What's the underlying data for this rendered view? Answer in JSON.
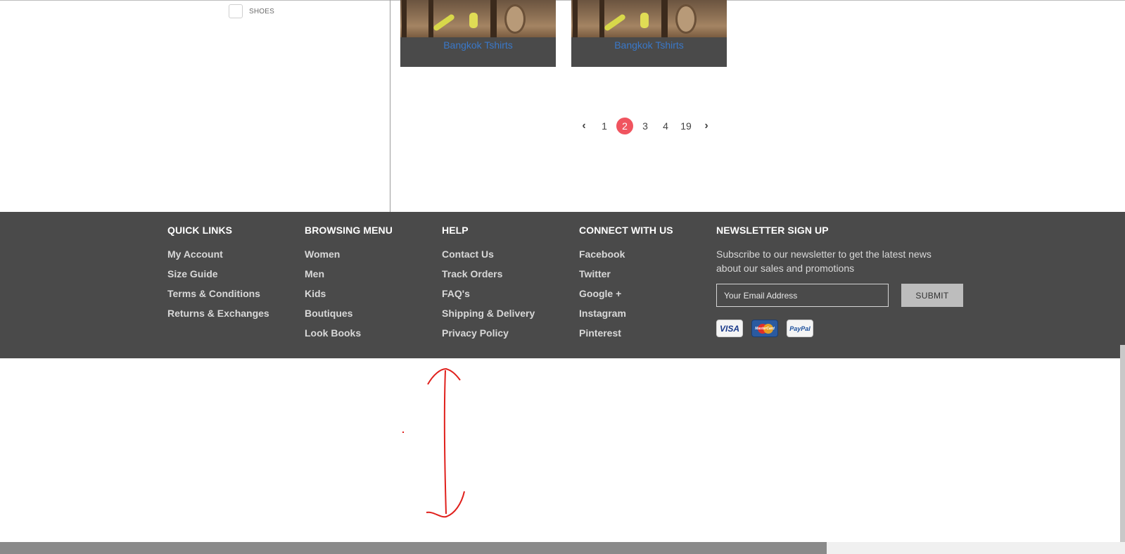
{
  "sidebar": {
    "filter_label": "SHOES"
  },
  "products": [
    {
      "title": "Bangkok Tshirts"
    },
    {
      "title": "Bangkok Tshirts"
    }
  ],
  "pagination": {
    "prev_icon": "chevron-left-icon",
    "next_icon": "chevron-right-icon",
    "prev_glyph": "‹",
    "next_glyph": "›",
    "pages": [
      "1",
      "2",
      "3",
      "4",
      "19"
    ],
    "current": "2",
    "active_color": "#f0545f"
  },
  "footer": {
    "background": "#4a4a4a",
    "quick_links": {
      "title": "QUICK LINKS",
      "items": [
        "My Account",
        "Size Guide",
        "Terms & Conditions",
        "Returns & Exchanges"
      ]
    },
    "browsing_menu": {
      "title": "BROWSING MENU",
      "items": [
        "Women",
        "Men",
        "Kids",
        "Boutiques",
        "Look Books"
      ]
    },
    "help": {
      "title": "HELP",
      "items": [
        "Contact Us",
        "Track Orders",
        "FAQ's",
        "Shipping & Delivery",
        "Privacy Policy"
      ]
    },
    "connect": {
      "title": "CONNECT WITH US",
      "items": [
        "Facebook",
        "Twitter",
        "Google +",
        "Instagram",
        "Pinterest"
      ]
    },
    "newsletter": {
      "title": "NEWSLETTER SIGN UP",
      "text": "Subscribe to our newsletter to get the latest news about our sales and promotions",
      "placeholder": "Your Email Address",
      "submit_label": "SUBMIT",
      "payments": {
        "visa": "VISA",
        "mastercard": "MasterCard",
        "paypal": "PayPal"
      }
    }
  },
  "annotation": {
    "color": "#e0201c",
    "shape": "double-headed-arrow-icon"
  }
}
